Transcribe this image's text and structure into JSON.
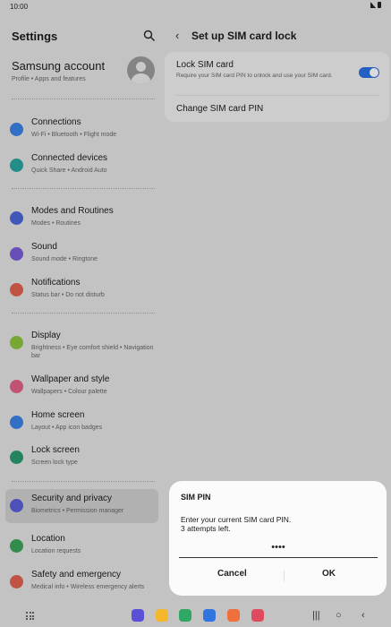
{
  "status": {
    "time": "10:00"
  },
  "left": {
    "title": "Settings",
    "account": {
      "name": "Samsung account",
      "sub": "Profile  •  Apps and features"
    },
    "items": [
      {
        "label": "Connections",
        "sub": "Wi-Fi  •  Bluetooth  •  Flight mode",
        "color": "#3b82e6",
        "icon": "wifi-icon"
      },
      {
        "label": "Connected devices",
        "sub": "Quick Share  •  Android Auto",
        "color": "#2aa4a0",
        "icon": "devices-icon"
      },
      {
        "label": "Modes and Routines",
        "sub": "Modes  •  Routines",
        "color": "#4b66d8",
        "icon": "check-circle-icon"
      },
      {
        "label": "Sound",
        "sub": "Sound mode  •  Ringtone",
        "color": "#7a5bd6",
        "icon": "speaker-icon"
      },
      {
        "label": "Notifications",
        "sub": "Status bar  •  Do not disturb",
        "color": "#e0614f",
        "icon": "bell-icon"
      },
      {
        "label": "Display",
        "sub": "Brightness  •  Eye comfort shield  •  Navigation bar",
        "color": "#8cc43d",
        "icon": "sun-icon"
      },
      {
        "label": "Wallpaper and style",
        "sub": "Wallpapers  •  Colour palette",
        "color": "#e06086",
        "icon": "image-icon"
      },
      {
        "label": "Home screen",
        "sub": "Layout  •  App icon badges",
        "color": "#3b82e6",
        "icon": "home-icon"
      },
      {
        "label": "Lock screen",
        "sub": "Screen lock type",
        "color": "#2a9a70",
        "icon": "lock-icon"
      },
      {
        "label": "Security and privacy",
        "sub": "Biometrics  •  Permission manager",
        "color": "#5a5fd8",
        "icon": "shield-icon"
      },
      {
        "label": "Location",
        "sub": "Location requests",
        "color": "#3aa35a",
        "icon": "location-pin-icon"
      },
      {
        "label": "Safety and emergency",
        "sub": "Medical info  •  Wireless emergency alerts",
        "color": "#e0614f",
        "icon": "emergency-icon"
      }
    ]
  },
  "right": {
    "title": "Set up SIM card lock",
    "lock": {
      "title": "Lock SIM card",
      "desc": "Require your SIM card PIN to unlock and use your SIM card.",
      "enabled": true
    },
    "change": "Change SIM card PIN"
  },
  "dialog": {
    "title": "SIM PIN",
    "message": "Enter your current SIM card PIN.",
    "attempts": "3 attempts left.",
    "pin_value": "••••",
    "cancel": "Cancel",
    "ok": "OK"
  },
  "dock": [
    {
      "name": "dock-app-internet",
      "color": "#5b4fd6"
    },
    {
      "name": "dock-app-files",
      "color": "#f5b72b"
    },
    {
      "name": "dock-app-phone",
      "color": "#2ea862"
    },
    {
      "name": "dock-app-messages",
      "color": "#3175e0"
    },
    {
      "name": "dock-app-contacts",
      "color": "#f0703c"
    },
    {
      "name": "dock-app-camera",
      "color": "#e04a5f"
    }
  ]
}
